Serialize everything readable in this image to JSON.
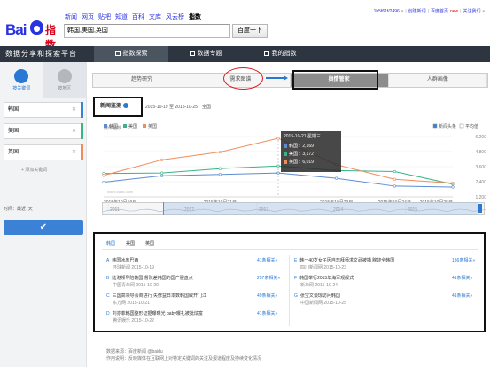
{
  "header": {
    "nav": [
      "新闻",
      "网页",
      "贴吧",
      "知道",
      "百科",
      "文库",
      "风云榜",
      "指数"
    ],
    "active_nav": "指数",
    "search_value": "韩国,美国,英国",
    "search_button": "百度一下",
    "logo_text_1": "Bai",
    "logo_text_2": "指数",
    "user_links": [
      "1b5f61f/2496",
      "▾",
      "|",
      "创建新词",
      "|",
      "百度首页",
      "new",
      "|",
      "关注我们",
      "▾"
    ]
  },
  "platform_title": "数据分享和探索平台",
  "main_tabs": [
    {
      "label": "指数探索",
      "active": true
    },
    {
      "label": "数据专题",
      "active": false
    },
    {
      "label": "我的指数",
      "active": false
    }
  ],
  "sidebar": {
    "tabs": [
      "按关键词",
      "按地区"
    ],
    "keywords": [
      {
        "label": "韩国",
        "color": "#3b82d6"
      },
      {
        "label": "美国",
        "color": "#39b486"
      },
      {
        "label": "英国",
        "color": "#f08c5c"
      }
    ],
    "add_keyword": "+ 添加关键词",
    "time_label": "时间：最近7天",
    "confirm_icon": "✔"
  },
  "sub_tabs": [
    {
      "label": "趋势研究",
      "active": false
    },
    {
      "label": "需求图谱",
      "active": false
    },
    {
      "label": "舆情管家",
      "active": true
    },
    {
      "label": "人群画像",
      "active": false
    }
  ],
  "monitor": {
    "title": "新闻监测",
    "date_range": "2015-10-19 至 2015-10-25",
    "all": "全国"
  },
  "chart_data": {
    "type": "line",
    "title": "新闻监测",
    "ylabel": "媒体指数",
    "x": [
      "2015年10月19日",
      "2015年10月20日",
      "2015年10月21日",
      "2015年10月22日",
      "2015年10月23日",
      "2015年10月24日",
      "2015年10月25日"
    ],
    "x_tick_labels": [
      "2015年10月19日",
      "2015年10月21日",
      "2015年10月23日",
      "2015年10月24日",
      "2015年10月25日"
    ],
    "y_tick_labels": [
      "6,200",
      "4,800",
      "3,600",
      "2,400",
      "1,200"
    ],
    "ylim": [
      0,
      6200
    ],
    "series": [
      {
        "name": "韩国",
        "color": "#5b8bd0",
        "values": [
          1500,
          2169,
          2300,
          2450,
          1900,
          1100,
          1000
        ]
      },
      {
        "name": "美国",
        "color": "#39b486",
        "values": [
          2400,
          2450,
          2900,
          3172,
          2700,
          2600,
          1300
        ]
      },
      {
        "name": "英国",
        "color": "#f08c5c",
        "values": [
          2200,
          3800,
          4600,
          6019,
          3300,
          1800,
          1400
        ]
      }
    ],
    "legend_right": [
      "新闻头条",
      "平均值"
    ],
    "overview_ticks": [
      "2011",
      "2012",
      "2013",
      "2014",
      "2015"
    ],
    "tooltip": {
      "date": "2015-10-21 星期三",
      "rows": [
        {
          "name": "韩国",
          "value": "2,169"
        },
        {
          "name": "美国",
          "value": "3,172"
        },
        {
          "name": "英国",
          "value": "6,019"
        }
      ]
    },
    "watermark": "index.baidu.com"
  },
  "news": {
    "tabs": [
      "韩国",
      "美国",
      "英国"
    ],
    "left": [
      {
        "letter": "A",
        "title": "韩国冰库巴西",
        "source": "环球新闻 2015-10-19",
        "related": "41条相关»"
      },
      {
        "letter": "B",
        "title": "陆港领导陪韩国 督阮差韩国的国产服盘点",
        "source": "中国青年网 2015-10-20",
        "related": "257条相关»"
      },
      {
        "letter": "C",
        "title": "三国高领导会商进行 失修益日本数韩国取开门江",
        "source": "东方网 2015-10-21",
        "related": "49条相关»"
      },
      {
        "letter": "D",
        "title": "刘亦菲韩国整形证据曝曝光 baby曝礼被批炫富",
        "source": "腾讯娱乐 2015-10-22",
        "related": "41条相关»"
      }
    ],
    "right": [
      {
        "letter": "E",
        "title": "韩一40岁女子因自恋拜师求文武被捕 腕饶全韩国",
        "source": "四川新闻网 2015-10-23",
        "related": "136条相关»"
      },
      {
        "letter": "F",
        "title": "韩国举行2015年海军观舰式",
        "source": "新华网 2015-10-24",
        "related": "41条相关»"
      },
      {
        "letter": "G",
        "title": "张宝文谈琼访问韩国",
        "source": "中国新闻网 2015-10-25",
        "related": "41条相关»"
      }
    ]
  },
  "footer": {
    "line1": "数据来源：百度新闻 @baidu",
    "line2": "作用说明：反映媒体在互联网上对特定关键词的关注及报道程度及持续变化情况"
  }
}
